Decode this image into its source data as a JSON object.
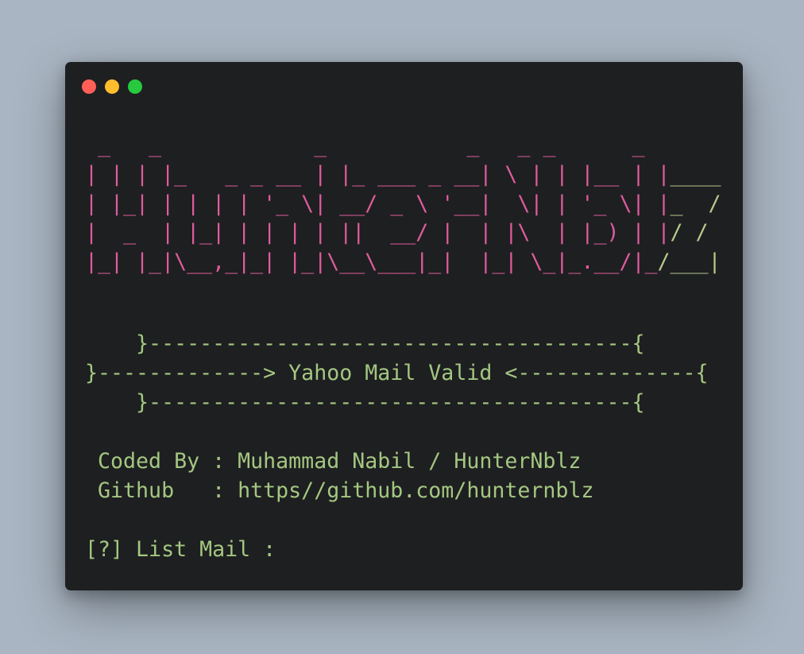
{
  "window": {
    "traffic_lights": {
      "close_color": "#ff5f56",
      "minimize_color": "#ffbd2e",
      "maximize_color": "#27c93f"
    }
  },
  "colors": {
    "background": "#a9b5c2",
    "terminal_bg": "#1e1f21",
    "banner_pink": "#df5c9d",
    "banner_green": "#b7c98a",
    "text_green": "#a4c781"
  },
  "terminal": {
    "ascii_banner": [
      {
        "pink": " _   _            _           _   _ _      _",
        "green": ""
      },
      {
        "pink": "| | | |_   _ _ __ | |_ ___ _ __| \\ | | |__ | |",
        "green": "____"
      },
      {
        "pink": "| |_| | | | | '_ \\| __/ _ \\ '__|  \\| | '_ \\| |",
        "green": "_  /"
      },
      {
        "pink": "|  _  | |_| | | | | ||  __/ |  | |\\  | |_) | |",
        "green": "/ /"
      },
      {
        "pink": "|_| |_|\\__,_|_| |_|\\__\\___|_|  |_| \\_|_.__/|_",
        "green": "/___|"
      }
    ],
    "divider_top": "    }--------------------------------------{",
    "title_line": "}-------------> Yahoo Mail Valid <--------------{",
    "divider_bottom": "    }--------------------------------------{",
    "coded_by": " Coded By : Muhammad Nabil / HunterNblz",
    "github": " Github   : https//github.com/hunternblz",
    "prompt": "[?] List Mail :"
  }
}
